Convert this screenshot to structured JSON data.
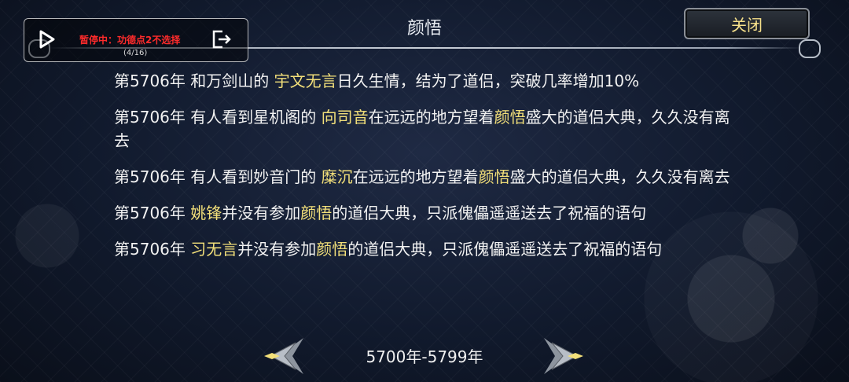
{
  "window": {
    "title": "颜悟"
  },
  "overlay": {
    "status": "暂停中：功德点2不选择",
    "count": "(4/16)"
  },
  "toolbar": {
    "close_label": "关闭"
  },
  "entries": [
    {
      "segments": [
        "第5706年 和万剑山的 ",
        "宇文无言",
        "日久生情，结为了道侣，突破几率增加10%"
      ]
    },
    {
      "segments": [
        "第5706年 有人看到星机阁的 ",
        "向司音",
        "在远远的地方望着",
        "颜悟",
        "盛大的道侣大典，久久没有离去"
      ]
    },
    {
      "segments": [
        "第5706年 有人看到妙音门的 ",
        "糜沉",
        "在远远的地方望着",
        "颜悟",
        "盛大的道侣大典，久久没有离去"
      ]
    },
    {
      "segments": [
        "第5706年 ",
        "姚锋",
        "并没有参加",
        "颜悟",
        "的道侣大典，只派傀儡遥遥送去了祝福的语句"
      ]
    },
    {
      "segments": [
        "第5706年 ",
        "习无言",
        "并没有参加",
        "颜悟",
        "的道侣大典，只派傀儡遥遥送去了祝福的语句"
      ]
    }
  ],
  "footer": {
    "range": "5700年-5799年"
  },
  "colors": {
    "highlight": "#f3e07a",
    "status_red": "#ff2b2b"
  }
}
